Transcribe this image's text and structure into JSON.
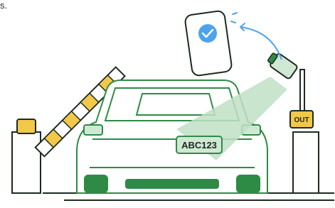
{
  "illustration": {
    "corner_text": "s.",
    "license_plate": "ABC123",
    "gate_sign": "OUT",
    "phone_status_icon": "check-circle-icon",
    "colors": {
      "line": "#1c2b1e",
      "green": "#2e8b45",
      "light_green": "#cfe8d3",
      "beam_green": "#bfe0c4",
      "yellow": "#f2c84b",
      "blue": "#4da3ee",
      "light_blue": "#e4f1fd",
      "white": "#ffffff"
    }
  }
}
